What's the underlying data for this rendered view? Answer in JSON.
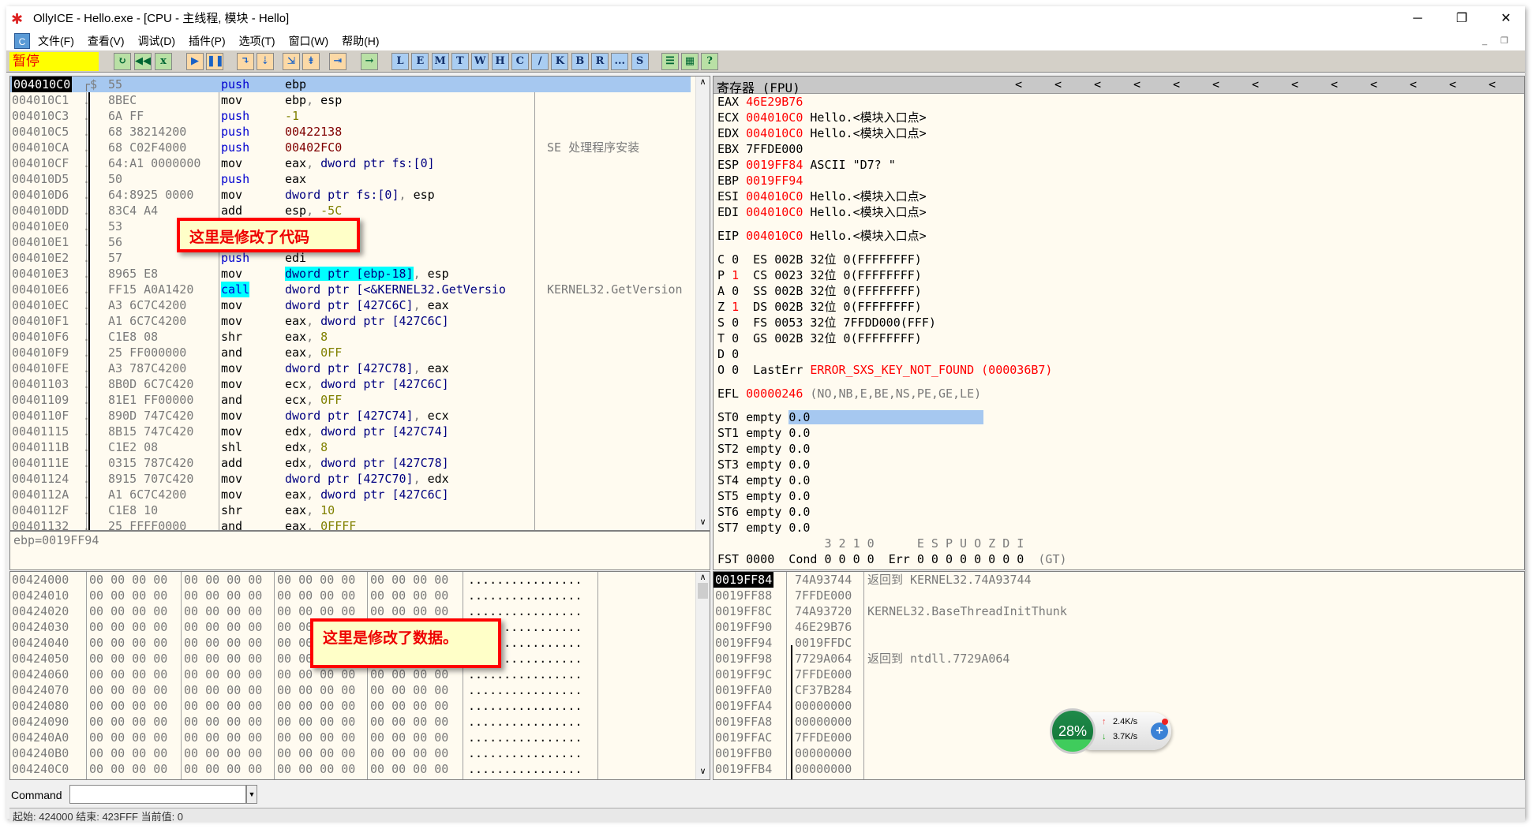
{
  "window": {
    "title": "OllyICE - Hello.exe - [CPU -  主线程, 模块 - Hello]",
    "minimize": "─",
    "restore": "❐",
    "close": "✕"
  },
  "menu": {
    "items": [
      "文件(F)",
      "查看(V)",
      "调试(D)",
      "插件(P)",
      "选项(T)",
      "窗口(W)",
      "帮助(H)"
    ],
    "app_icon": "C"
  },
  "toolbar": {
    "status": "暂停",
    "status_color": "#ffff00",
    "icons": [
      {
        "name": "open-icon",
        "g": "↻",
        "c": "g"
      },
      {
        "name": "restart-icon",
        "g": "◀◀",
        "c": "g"
      },
      {
        "name": "close-icon",
        "g": "x",
        "c": "g"
      },
      {
        "name": "run-icon",
        "g": "▶",
        "c": "o"
      },
      {
        "name": "pause-icon",
        "g": "❚❚",
        "c": "o"
      },
      {
        "name": "step-into-icon",
        "g": "↴",
        "c": "o"
      },
      {
        "name": "step-over-icon",
        "g": "⇣",
        "c": "o"
      },
      {
        "name": "trace-into-icon",
        "g": "⇲",
        "c": "o"
      },
      {
        "name": "trace-over-icon",
        "g": "⇟",
        "c": "o"
      },
      {
        "name": "execute-till-return-icon",
        "g": "⇥",
        "c": "o"
      },
      {
        "name": "goto-icon",
        "g": "→",
        "c": "g"
      }
    ],
    "letters": [
      "L",
      "E",
      "M",
      "T",
      "W",
      "H",
      "C",
      "/",
      "K",
      "B",
      "R",
      "...",
      "S"
    ],
    "extra": [
      {
        "name": "list-icon",
        "g": "☰"
      },
      {
        "name": "palette-icon",
        "g": "▦"
      },
      {
        "name": "help-icon",
        "g": "?"
      }
    ]
  },
  "disasm": {
    "rows": [
      {
        "addr": "004010C0",
        "mark": "┌$",
        "bytes": "55",
        "mn": "push",
        "ops": [
          [
            "ebp",
            "blk"
          ]
        ],
        "sel": true
      },
      {
        "addr": "004010C1",
        "mark": ".",
        "bytes": "8BEC",
        "mn": "mov",
        "ops": [
          [
            "ebp",
            "blk"
          ],
          [
            ", ",
            "gray"
          ],
          [
            "esp",
            "blk"
          ]
        ]
      },
      {
        "addr": "004010C3",
        "mark": ".",
        "bytes": "6A FF",
        "mn": "push",
        "ops": [
          [
            "-1",
            "olive"
          ]
        ]
      },
      {
        "addr": "004010C5",
        "mark": ".",
        "bytes": "68 38214200",
        "mn": "push",
        "ops": [
          [
            "00422138",
            "dred"
          ]
        ]
      },
      {
        "addr": "004010CA",
        "mark": ".",
        "bytes": "68 C02F4000",
        "mn": "push",
        "ops": [
          [
            "00402FC0",
            "dred"
          ]
        ],
        "comment": "SE 处理程序安装"
      },
      {
        "addr": "004010CF",
        "mark": ".",
        "bytes": "64:A1 0000000",
        "mn": "mov",
        "ops": [
          [
            "eax",
            "blk"
          ],
          [
            ", ",
            "gray"
          ],
          [
            "dword ptr fs:[0]",
            "navy"
          ]
        ]
      },
      {
        "addr": "004010D5",
        "mark": ".",
        "bytes": "50",
        "mn": "push",
        "ops": [
          [
            "eax",
            "blk"
          ]
        ]
      },
      {
        "addr": "004010D6",
        "mark": ".",
        "bytes": "64:8925 0000",
        "mn": "mov",
        "ops": [
          [
            "dword ptr fs:[0]",
            "navy"
          ],
          [
            ", ",
            "gray"
          ],
          [
            "esp",
            "blk"
          ]
        ]
      },
      {
        "addr": "004010DD",
        "mark": ".",
        "bytes": "83C4 A4",
        "mn": "add",
        "ops": [
          [
            "esp",
            "blk"
          ],
          [
            ", ",
            "gray"
          ],
          [
            "-5C",
            "olive"
          ]
        ]
      },
      {
        "addr": "004010E0",
        "mark": ".",
        "bytes": "53",
        "mn": "",
        "ops": []
      },
      {
        "addr": "004010E1",
        "mark": ".",
        "bytes": "56",
        "mn": "",
        "ops": []
      },
      {
        "addr": "004010E2",
        "mark": ".",
        "bytes": "57",
        "mn": "push",
        "ops": [
          [
            "edi",
            "blk"
          ]
        ]
      },
      {
        "addr": "004010E3",
        "mark": ".",
        "bytes": "8965 E8",
        "mn": "mov",
        "ops": [
          [
            "dword ptr [ebp-18]",
            "navy hl"
          ],
          [
            ", ",
            "gray"
          ],
          [
            "esp",
            "blk"
          ]
        ]
      },
      {
        "addr": "004010E6",
        "mark": ".",
        "bytes": "FF15 A0A1420",
        "mn": "call",
        "mnhl": true,
        "ops": [
          [
            "dword ptr [<&KERNEL32.GetVersio",
            "navy"
          ]
        ],
        "comment": "KERNEL32.GetVersion"
      },
      {
        "addr": "004010EC",
        "mark": ".",
        "bytes": "A3 6C7C4200",
        "mn": "mov",
        "ops": [
          [
            "dword ptr [427C6C]",
            "navy"
          ],
          [
            ", ",
            "gray"
          ],
          [
            "eax",
            "blk"
          ]
        ]
      },
      {
        "addr": "004010F1",
        "mark": ".",
        "bytes": "A1 6C7C4200",
        "mn": "mov",
        "ops": [
          [
            "eax",
            "blk"
          ],
          [
            ", ",
            "gray"
          ],
          [
            "dword ptr [427C6C]",
            "navy"
          ]
        ]
      },
      {
        "addr": "004010F6",
        "mark": ".",
        "bytes": "C1E8 08",
        "mn": "shr",
        "ops": [
          [
            "eax",
            "blk"
          ],
          [
            ", ",
            "gray"
          ],
          [
            "8",
            "olive"
          ]
        ]
      },
      {
        "addr": "004010F9",
        "mark": ".",
        "bytes": "25 FF000000",
        "mn": "and",
        "ops": [
          [
            "eax",
            "blk"
          ],
          [
            ", ",
            "gray"
          ],
          [
            "0FF",
            "olive"
          ]
        ]
      },
      {
        "addr": "004010FE",
        "mark": ".",
        "bytes": "A3 787C4200",
        "mn": "mov",
        "ops": [
          [
            "dword ptr [427C78]",
            "navy"
          ],
          [
            ", ",
            "gray"
          ],
          [
            "eax",
            "blk"
          ]
        ]
      },
      {
        "addr": "00401103",
        "mark": ".",
        "bytes": "8B0D 6C7C420",
        "mn": "mov",
        "ops": [
          [
            "ecx",
            "blk"
          ],
          [
            ", ",
            "gray"
          ],
          [
            "dword ptr [427C6C]",
            "navy"
          ]
        ]
      },
      {
        "addr": "00401109",
        "mark": ".",
        "bytes": "81E1 FF00000",
        "mn": "and",
        "ops": [
          [
            "ecx",
            "blk"
          ],
          [
            ", ",
            "gray"
          ],
          [
            "0FF",
            "olive"
          ]
        ]
      },
      {
        "addr": "0040110F",
        "mark": ".",
        "bytes": "890D 747C420",
        "mn": "mov",
        "ops": [
          [
            "dword ptr [427C74]",
            "navy"
          ],
          [
            ", ",
            "gray"
          ],
          [
            "ecx",
            "blk"
          ]
        ]
      },
      {
        "addr": "00401115",
        "mark": ".",
        "bytes": "8B15 747C420",
        "mn": "mov",
        "ops": [
          [
            "edx",
            "blk"
          ],
          [
            ", ",
            "gray"
          ],
          [
            "dword ptr [427C74]",
            "navy"
          ]
        ]
      },
      {
        "addr": "0040111B",
        "mark": ".",
        "bytes": "C1E2 08",
        "mn": "shl",
        "ops": [
          [
            "edx",
            "blk"
          ],
          [
            ", ",
            "gray"
          ],
          [
            "8",
            "olive"
          ]
        ]
      },
      {
        "addr": "0040111E",
        "mark": ".",
        "bytes": "0315 787C420",
        "mn": "add",
        "ops": [
          [
            "edx",
            "blk"
          ],
          [
            ", ",
            "gray"
          ],
          [
            "dword ptr [427C78]",
            "navy"
          ]
        ]
      },
      {
        "addr": "00401124",
        "mark": ".",
        "bytes": "8915 707C420",
        "mn": "mov",
        "ops": [
          [
            "dword ptr [427C70]",
            "navy"
          ],
          [
            ", ",
            "gray"
          ],
          [
            "edx",
            "blk"
          ]
        ]
      },
      {
        "addr": "0040112A",
        "mark": ".",
        "bytes": "A1 6C7C4200",
        "mn": "mov",
        "ops": [
          [
            "eax",
            "blk"
          ],
          [
            ", ",
            "gray"
          ],
          [
            "dword ptr [427C6C]",
            "navy"
          ]
        ]
      },
      {
        "addr": "0040112F",
        "mark": ".",
        "bytes": "C1E8 10",
        "mn": "shr",
        "ops": [
          [
            "eax",
            "blk"
          ],
          [
            ", ",
            "gray"
          ],
          [
            "10",
            "olive"
          ]
        ]
      },
      {
        "addr": "00401132",
        "mark": ".",
        "bytes": "25 FFFF0000",
        "mn": "and",
        "ops": [
          [
            "eax",
            "blk"
          ],
          [
            ", ",
            "gray"
          ],
          [
            "0FFFF",
            "olive"
          ]
        ]
      }
    ],
    "info": "ebp=0019FF94"
  },
  "callouts": {
    "code": "这里是修改了代码",
    "data": "这里是修改了数据。"
  },
  "registers": {
    "header": "寄存器 (FPU)",
    "arrows": "<",
    "lines": [
      [
        [
          "EAX ",
          "blk"
        ],
        [
          "46E29B76",
          "red"
        ]
      ],
      [
        [
          "ECX ",
          "blk"
        ],
        [
          "004010C0",
          "red"
        ],
        [
          " Hello.<模块入口点>",
          "blk"
        ]
      ],
      [
        [
          "EDX ",
          "blk"
        ],
        [
          "004010C0",
          "red"
        ],
        [
          " Hello.<模块入口点>",
          "blk"
        ]
      ],
      [
        [
          "EBX ",
          "blk"
        ],
        [
          "7FFDE000",
          "blk"
        ]
      ],
      [
        [
          "ESP ",
          "blk"
        ],
        [
          "0019FF84",
          "red"
        ],
        [
          " ASCII \"D7? \"",
          "blk"
        ]
      ],
      [
        [
          "EBP ",
          "blk"
        ],
        [
          "0019FF94",
          "red"
        ]
      ],
      [
        [
          "ESI ",
          "blk"
        ],
        [
          "004010C0",
          "red"
        ],
        [
          " Hello.<模块入口点>",
          "blk"
        ]
      ],
      [
        [
          "EDI ",
          "blk"
        ],
        [
          "004010C0",
          "red"
        ],
        [
          " Hello.<模块入口点>",
          "blk"
        ]
      ],
      [
        [
          "EIP ",
          "blk"
        ],
        [
          "004010C0",
          "red"
        ],
        [
          " Hello.<模块入口点>",
          "blk"
        ]
      ],
      [
        [
          "C ",
          "blk"
        ],
        [
          "0",
          "blk"
        ],
        [
          "  ES 002B 32位 0(FFFFFFFF)",
          "blk"
        ]
      ],
      [
        [
          "P ",
          "blk"
        ],
        [
          "1",
          "red"
        ],
        [
          "  CS 0023 32位 0(FFFFFFFF)",
          "blk"
        ]
      ],
      [
        [
          "A ",
          "blk"
        ],
        [
          "0",
          "blk"
        ],
        [
          "  SS 002B 32位 0(FFFFFFFF)",
          "blk"
        ]
      ],
      [
        [
          "Z ",
          "blk"
        ],
        [
          "1",
          "red"
        ],
        [
          "  DS 002B 32位 0(FFFFFFFF)",
          "blk"
        ]
      ],
      [
        [
          "S ",
          "blk"
        ],
        [
          "0",
          "blk"
        ],
        [
          "  FS 0053 32位 7FFDD000(FFF)",
          "blk"
        ]
      ],
      [
        [
          "T ",
          "blk"
        ],
        [
          "0",
          "blk"
        ],
        [
          "  GS 002B 32位 0(FFFFFFFF)",
          "blk"
        ]
      ],
      [
        [
          "D ",
          "blk"
        ],
        [
          "0",
          "blk"
        ]
      ],
      [
        [
          "O ",
          "blk"
        ],
        [
          "0",
          "blk"
        ],
        [
          "  LastErr ",
          "blk"
        ],
        [
          "ERROR_SXS_KEY_NOT_FOUND (000036B7)",
          "red"
        ]
      ],
      [
        [
          "EFL ",
          "blk"
        ],
        [
          "00000246",
          "red"
        ],
        [
          " (NO,NB,E,BE,NS,PE,GE,LE)",
          "gray"
        ]
      ],
      [
        [
          "ST0 empty ",
          "blk"
        ],
        [
          "0.0",
          "blk hlv"
        ]
      ],
      [
        [
          "ST1 empty ",
          "blk"
        ],
        [
          "0.0",
          "blk"
        ]
      ],
      [
        [
          "ST2 empty ",
          "blk"
        ],
        [
          "0.0",
          "blk"
        ]
      ],
      [
        [
          "ST3 empty ",
          "blk"
        ],
        [
          "0.0",
          "blk"
        ]
      ],
      [
        [
          "ST4 empty ",
          "blk"
        ],
        [
          "0.0",
          "blk"
        ]
      ],
      [
        [
          "ST5 empty ",
          "blk"
        ],
        [
          "0.0",
          "blk"
        ]
      ],
      [
        [
          "ST6 empty ",
          "blk"
        ],
        [
          "0.0",
          "blk"
        ]
      ],
      [
        [
          "ST7 empty ",
          "blk"
        ],
        [
          "0.0",
          "blk"
        ]
      ],
      [
        [
          "               3 2 1 0      E S P U O Z D I",
          "gray"
        ]
      ],
      [
        [
          "FST 0000  Cond 0 0 0 0  Err 0 0 0 0 0 0 0 0  ",
          "blk"
        ],
        [
          "(GT)",
          "gray"
        ]
      ]
    ]
  },
  "dump": {
    "rows": [
      {
        "addr": "00424000"
      },
      {
        "addr": "00424010"
      },
      {
        "addr": "00424020"
      },
      {
        "addr": "00424030"
      },
      {
        "addr": "00424040"
      },
      {
        "addr": "00424050"
      },
      {
        "addr": "00424060"
      },
      {
        "addr": "00424070"
      },
      {
        "addr": "00424080"
      },
      {
        "addr": "00424090"
      },
      {
        "addr": "004240A0"
      },
      {
        "addr": "004240B0"
      },
      {
        "addr": "004240C0"
      }
    ],
    "hex_group": "00 00 00 00",
    "ascii": "................"
  },
  "stack": {
    "rows": [
      {
        "addr": "0019FF84",
        "val": "74A93744",
        "comment": "返回到 KERNEL32.74A93744",
        "sel": true
      },
      {
        "addr": "0019FF88",
        "val": "7FFDE000",
        "comment": ""
      },
      {
        "addr": "0019FF8C",
        "val": "74A93720",
        "comment": "KERNEL32.BaseThreadInitThunk"
      },
      {
        "addr": "0019FF90",
        "val": "46E29B76",
        "comment": ""
      },
      {
        "addr": "0019FF94",
        "val": "0019FFDC",
        "comment": ""
      },
      {
        "addr": "0019FF98",
        "val": "7729A064",
        "comment": "返回到 ntdll.7729A064"
      },
      {
        "addr": "0019FF9C",
        "val": "7FFDE000",
        "comment": ""
      },
      {
        "addr": "0019FFA0",
        "val": "CF37B284",
        "comment": ""
      },
      {
        "addr": "0019FFA4",
        "val": "00000000",
        "comment": ""
      },
      {
        "addr": "0019FFA8",
        "val": "00000000",
        "comment": ""
      },
      {
        "addr": "0019FFAC",
        "val": "7FFDE000",
        "comment": ""
      },
      {
        "addr": "0019FFB0",
        "val": "00000000",
        "comment": ""
      },
      {
        "addr": "0019FFB4",
        "val": "00000000",
        "comment": ""
      }
    ]
  },
  "command": {
    "label": "Command",
    "value": ""
  },
  "statusbar": {
    "text": "起始: 424000 结束: 423FFF 当前值: 0"
  },
  "net_widget": {
    "percent": "28%",
    "upload": "2.4K/s",
    "download": "3.7K/s",
    "plus": "+"
  }
}
